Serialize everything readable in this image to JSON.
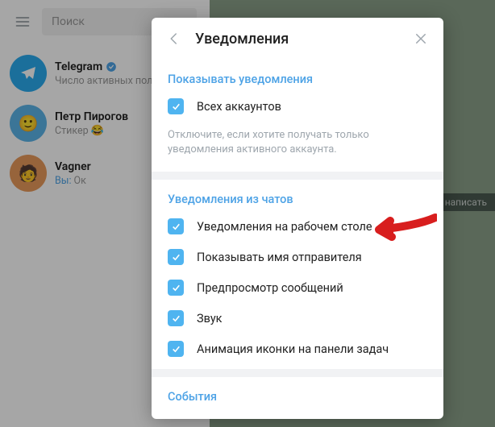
{
  "search": {
    "placeholder": "Поиск"
  },
  "chats": [
    {
      "name": "Telegram",
      "subtitle": "Число активных поль",
      "verified": true
    },
    {
      "name": "Петр Пирогов",
      "subtitle": "Стикер",
      "sticker": "😂"
    },
    {
      "name": "Vagner",
      "you": "Вы:",
      "subtitle": "Ок"
    }
  ],
  "modal": {
    "title": "Уведомления",
    "section1_title": "Показывать уведомления",
    "opt_all_accounts": "Всех аккаунтов",
    "hint1": "Отключите, если хотите получать только уведомления активного аккаунта.",
    "section2_title": "Уведомления из чатов",
    "opt_desktop": "Уведомления на рабочем столе",
    "opt_sender": "Показывать имя отправителя",
    "opt_preview": "Предпросмотр сообщений",
    "opt_sound": "Звук",
    "opt_anim": "Анимация иконки на панели задач",
    "section3_title": "События"
  },
  "write_label": "написать"
}
